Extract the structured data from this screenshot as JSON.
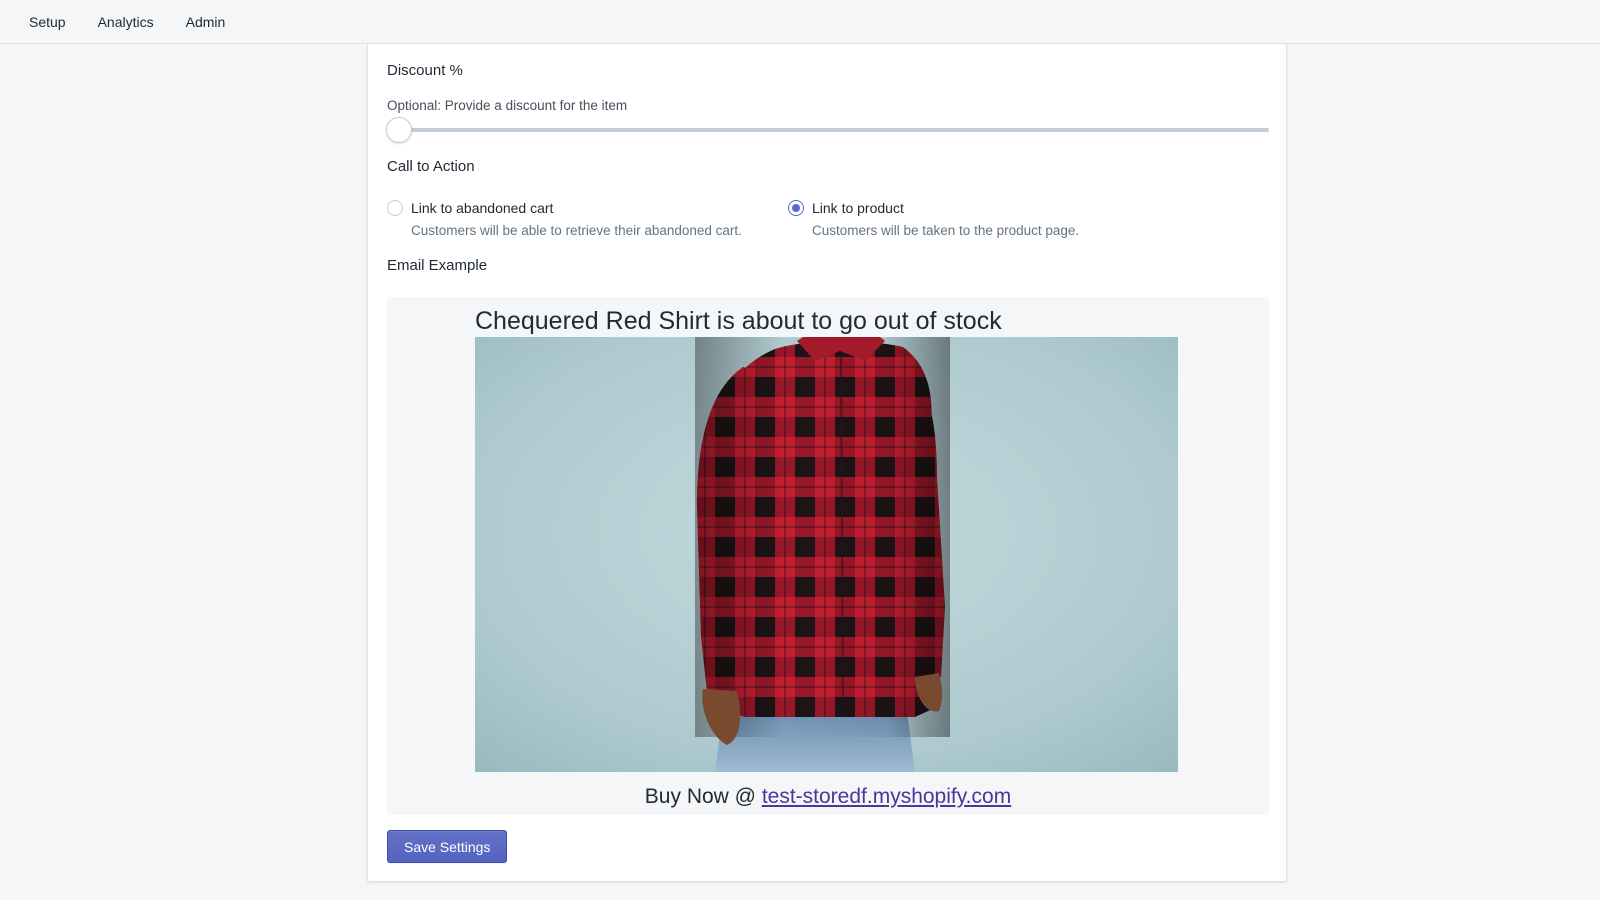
{
  "nav": {
    "items": [
      "Setup",
      "Analytics",
      "Admin"
    ]
  },
  "discount": {
    "title": "Discount %",
    "help": "Optional: Provide a discount for the item",
    "value_percent": 0
  },
  "cta": {
    "title": "Call to Action",
    "options": [
      {
        "label": "Link to abandoned cart",
        "description": "Customers will be able to retrieve their abandoned cart.",
        "checked": false
      },
      {
        "label": "Link to product",
        "description": "Customers will be taken to the product page.",
        "checked": true
      }
    ]
  },
  "email_example": {
    "title": "Email Example",
    "headline": "Chequered Red Shirt is about to go out of stock",
    "buy_prefix": "Buy Now @ ",
    "store_link": "test-storedf.myshopify.com"
  },
  "save_button": {
    "label": "Save Settings"
  },
  "colors": {
    "accent": "#5c6ac4",
    "link": "#47389a",
    "background": "#f4f6f8"
  }
}
